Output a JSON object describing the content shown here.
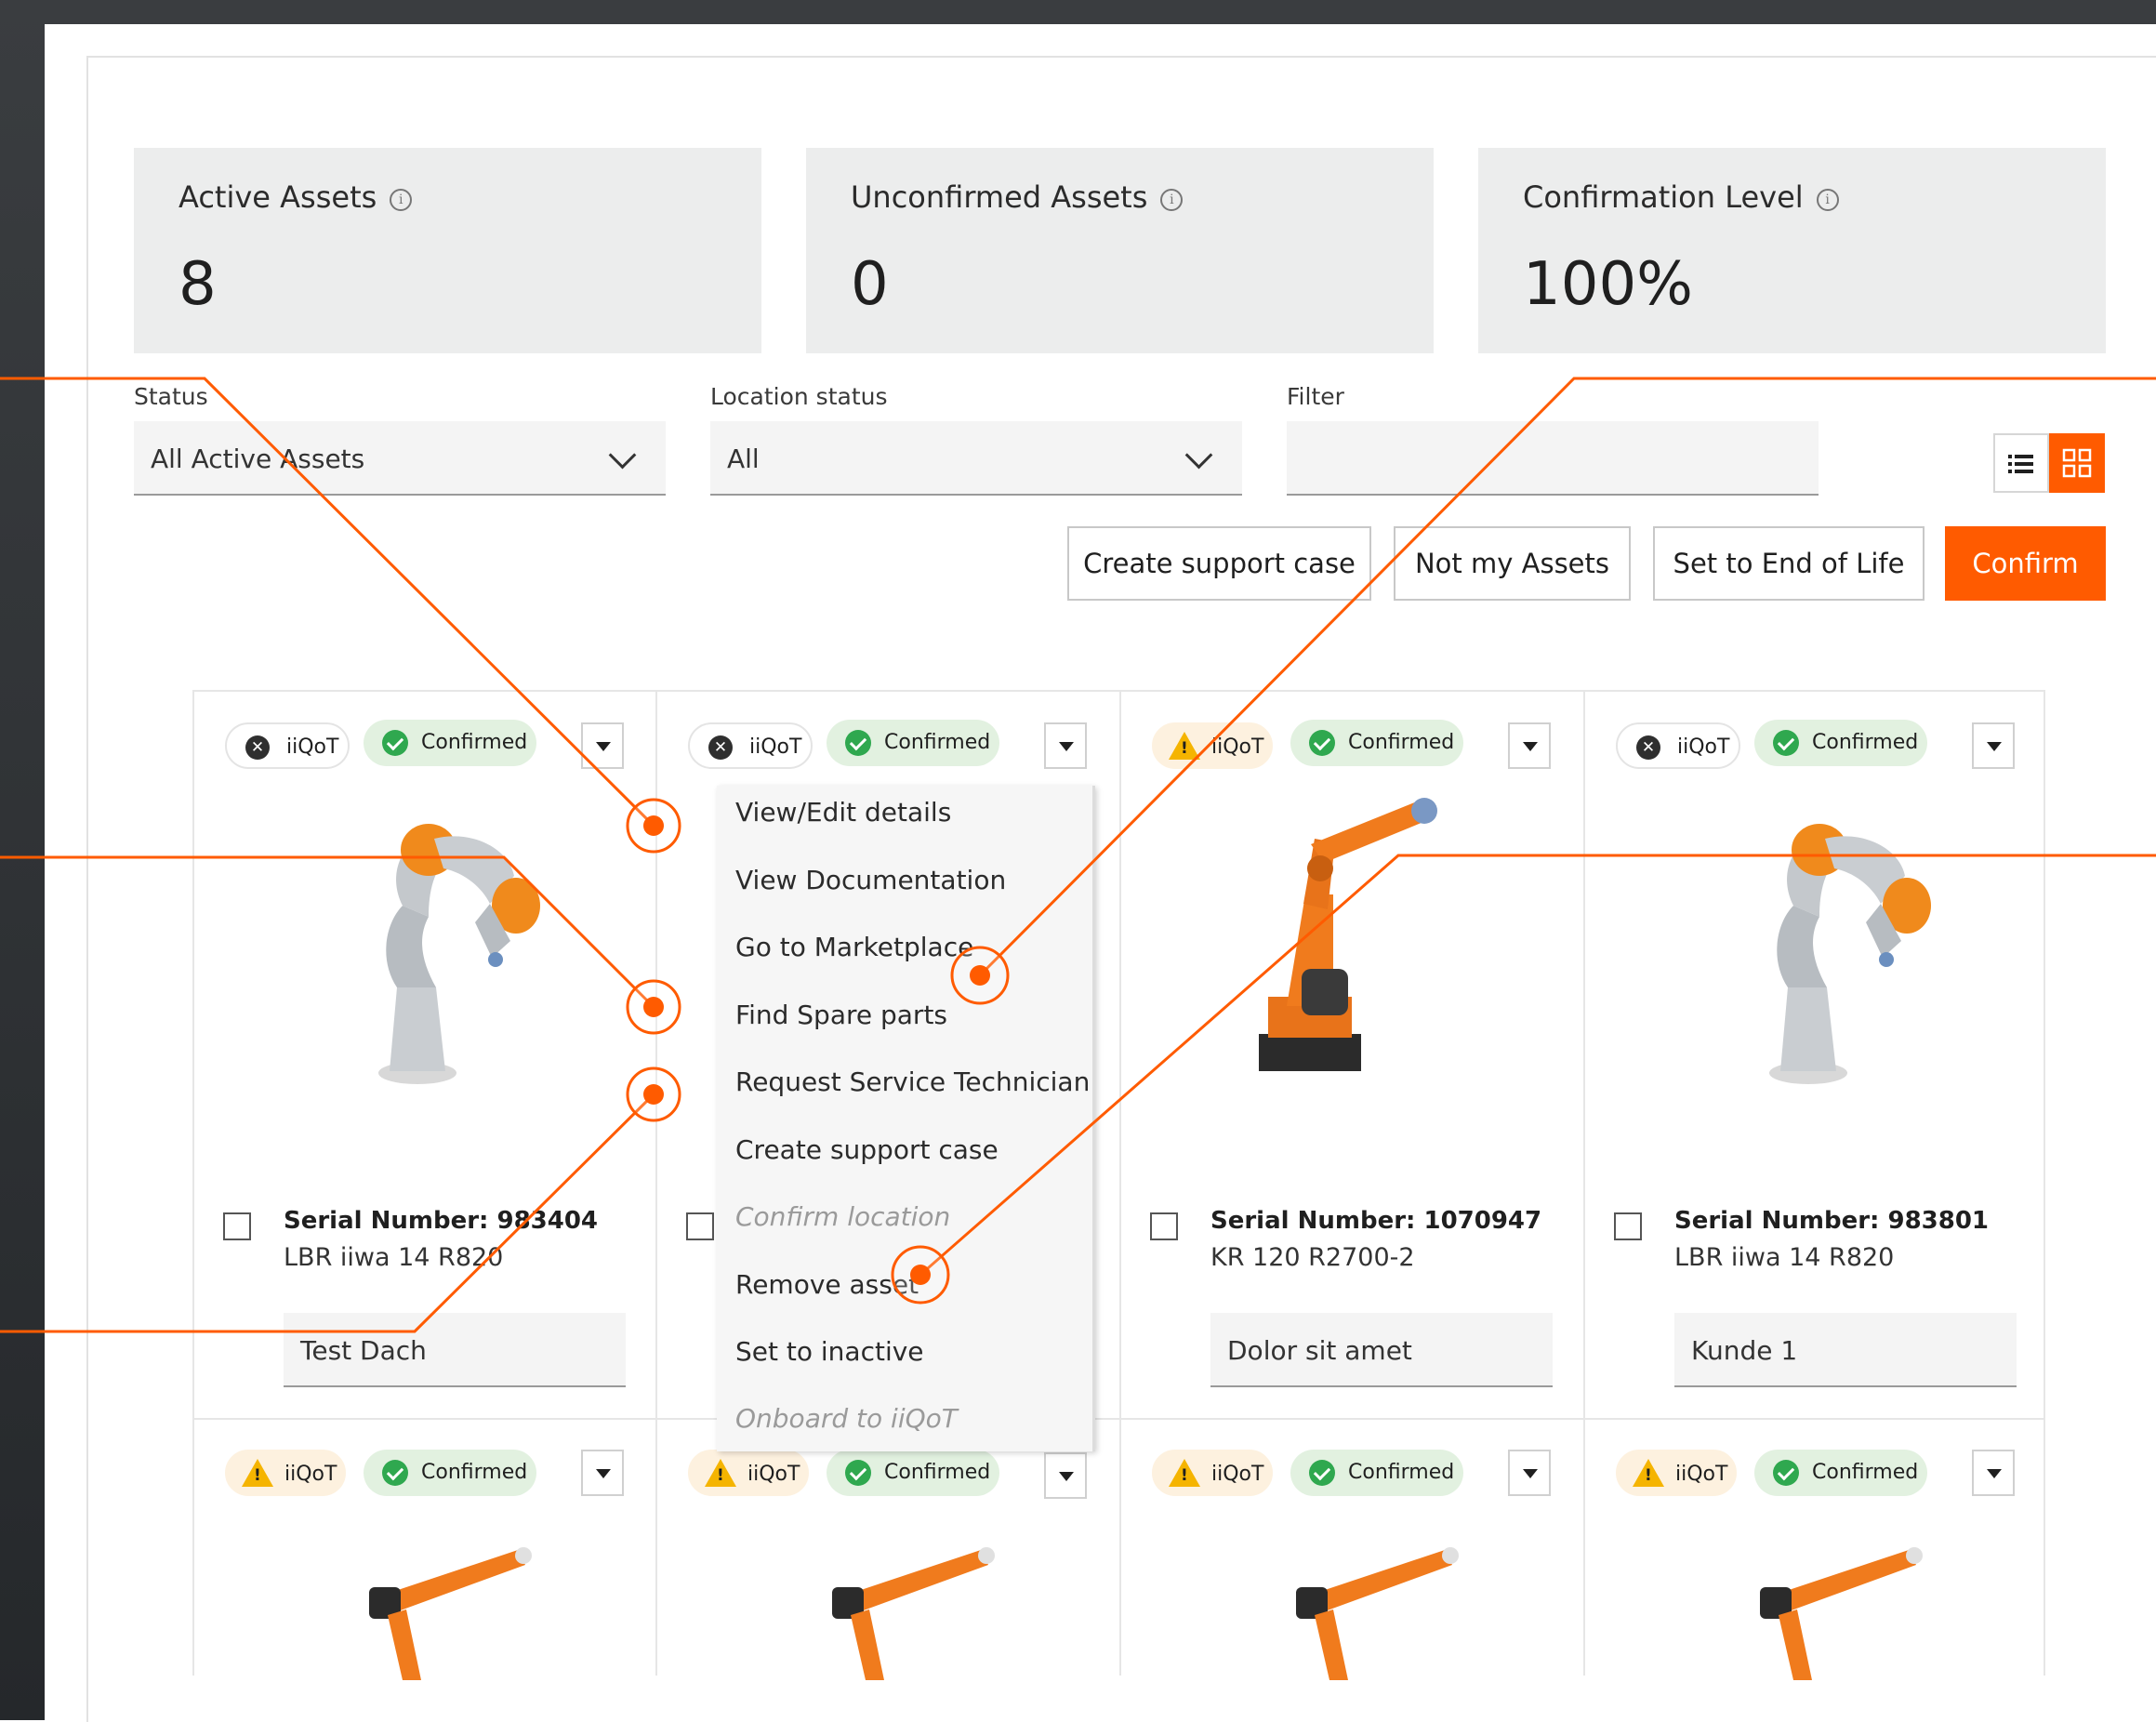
{
  "kpis": [
    {
      "title": "Active Assets",
      "value": "8"
    },
    {
      "title": "Unconfirmed Assets",
      "value": "0"
    },
    {
      "title": "Confirmation Level",
      "value": "100%"
    }
  ],
  "filters": {
    "status_label": "Status",
    "status_value": "All Active Assets",
    "location_label": "Location status",
    "location_value": "All",
    "filter_label": "Filter",
    "filter_value": ""
  },
  "actions": {
    "support": "Create support case",
    "not_mine": "Not my Assets",
    "end_of_life": "Set to End of Life",
    "confirm": "Confirm"
  },
  "badges": {
    "iiqot": "iiQoT",
    "confirmed": "Confirmed"
  },
  "assets": [
    {
      "serial": "Serial Number: 983404",
      "model": "LBR iiwa 14 R820",
      "location": "Test Dach",
      "iiqot_state": "off"
    },
    {
      "serial": "",
      "model": "",
      "location": "",
      "iiqot_state": "off"
    },
    {
      "serial": "Serial Number: 1070947",
      "model": "KR 120 R2700-2",
      "location": "Dolor sit amet",
      "iiqot_state": "warning"
    },
    {
      "serial": "Serial Number: 983801",
      "model": "LBR iiwa 14 R820",
      "location": "Kunde 1",
      "iiqot_state": "off"
    }
  ],
  "menu_items": [
    {
      "label": "View/Edit details",
      "enabled": true
    },
    {
      "label": "View Documentation",
      "enabled": true
    },
    {
      "label": "Go to Marketplace",
      "enabled": true
    },
    {
      "label": "Find Spare parts",
      "enabled": true
    },
    {
      "label": "Request Service Technician",
      "enabled": true
    },
    {
      "label": "Create support case",
      "enabled": true
    },
    {
      "label": "Confirm location",
      "enabled": false
    },
    {
      "label": "Remove asset",
      "enabled": true
    },
    {
      "label": "Set to inactive",
      "enabled": true
    },
    {
      "label": "Onboard to iiQoT",
      "enabled": false
    }
  ],
  "colors": {
    "accent": "#ff5b00",
    "confirmed_bg": "#e2f1e0",
    "warning": "#f5b400"
  },
  "icons": [
    "info-icon",
    "chevron-down-icon",
    "list-view-icon",
    "grid-view-icon",
    "close-icon",
    "check-icon",
    "warning-icon",
    "caret-down-icon"
  ]
}
